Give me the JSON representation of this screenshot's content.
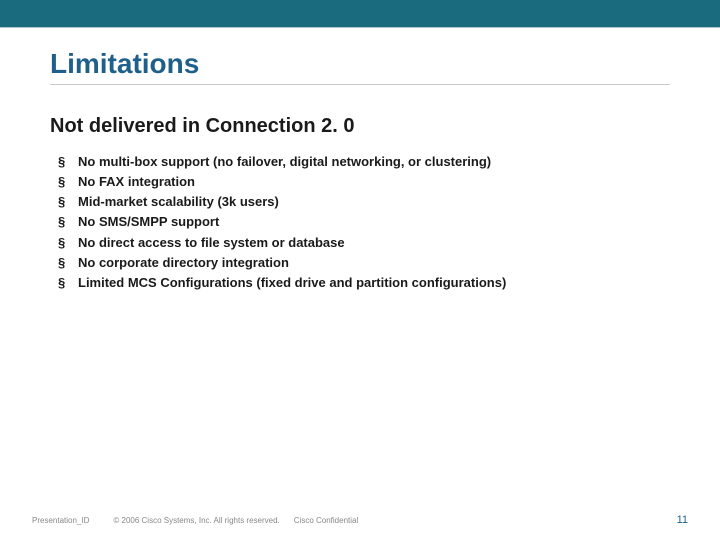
{
  "slide": {
    "title": "Limitations",
    "subtitle": "Not delivered in Connection 2. 0",
    "bullets": [
      "No multi-box support (no failover, digital networking, or clustering)",
      "No FAX integration",
      "Mid-market scalability (3k users)",
      "No SMS/SMPP support",
      "No direct access to file system or database",
      "No corporate directory integration",
      "Limited MCS Configurations (fixed drive and partition configurations)"
    ]
  },
  "footer": {
    "presentation_id": "Presentation_ID",
    "copyright": "© 2006 Cisco Systems, Inc. All rights reserved.",
    "confidential": "Cisco Confidential",
    "page_number": "11"
  },
  "colors": {
    "top_bar": "#1a6b7d",
    "title": "#1f5f8b"
  }
}
